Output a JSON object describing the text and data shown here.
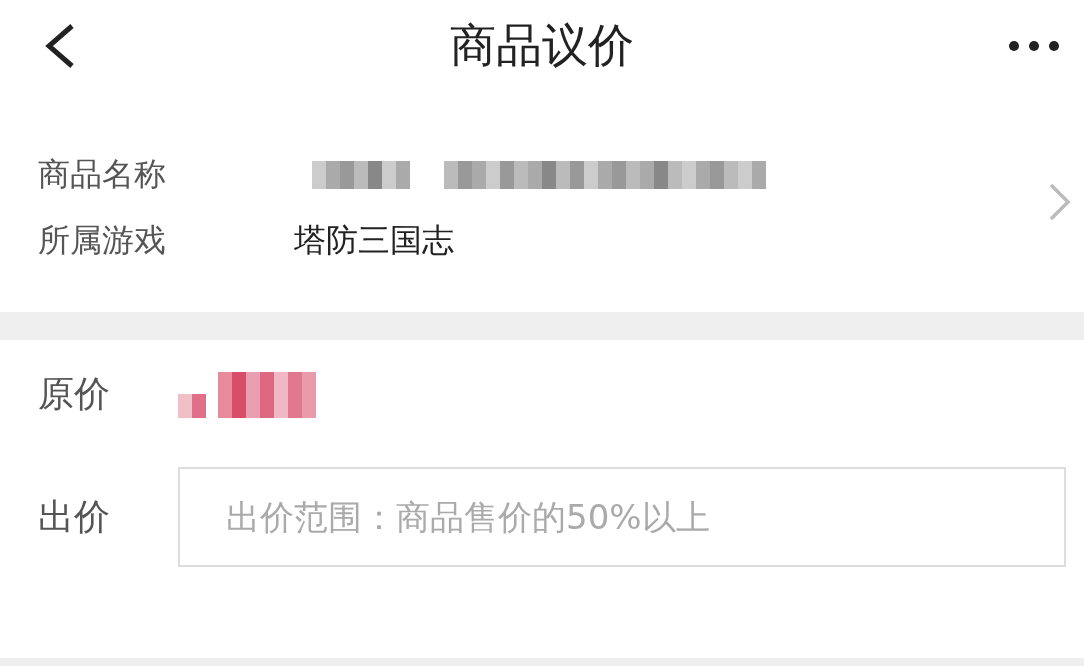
{
  "header": {
    "title": "商品议价"
  },
  "product_info": {
    "rows": [
      {
        "label": "商品名称",
        "kind": "blurred"
      },
      {
        "label": "所属游戏",
        "kind": "text",
        "value": "塔防三国志"
      }
    ]
  },
  "offer": {
    "rows": [
      {
        "label": "原价",
        "kind": "blurred_price"
      },
      {
        "label": "出价",
        "kind": "input",
        "placeholder": "出价范围：商品售价的50%以上"
      }
    ]
  }
}
